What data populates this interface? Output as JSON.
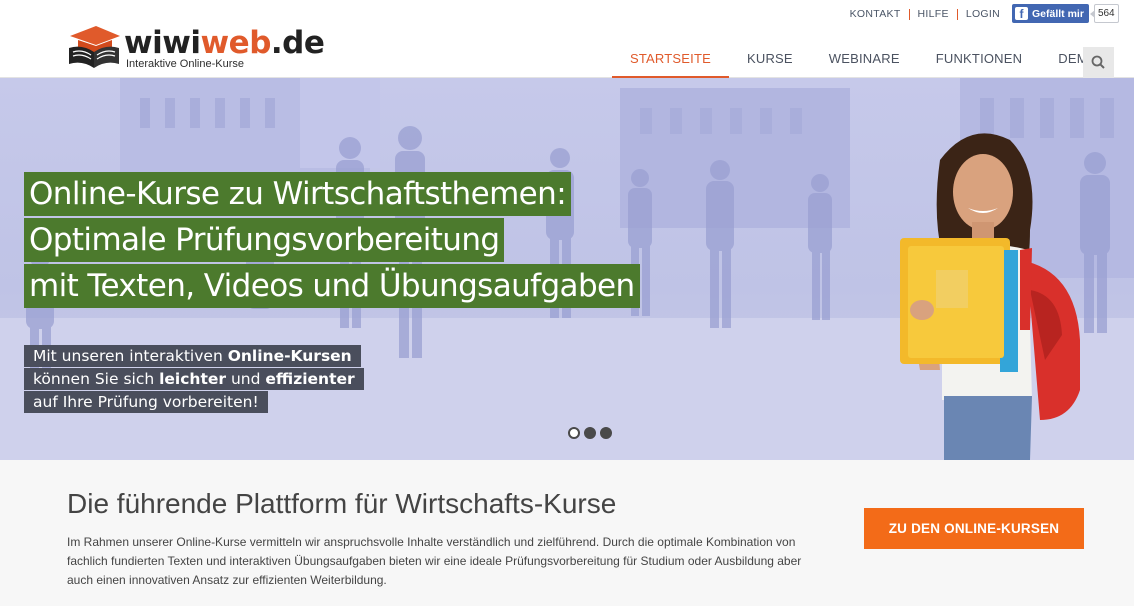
{
  "logo": {
    "word_a": "wiwi",
    "word_b": "web",
    "word_c": ".de",
    "tagline": "Interaktive Online-Kurse"
  },
  "util_nav": {
    "kontakt": "KONTAKT",
    "hilfe": "HILFE",
    "login": "LOGIN"
  },
  "facebook": {
    "like_label": "Gefällt mir",
    "count": "564"
  },
  "nav": {
    "items": [
      "STARTSEITE",
      "KURSE",
      "WEBINARE",
      "FUNKTIONEN",
      "DEMO"
    ],
    "active_index": 0
  },
  "hero": {
    "headline": [
      "Online-Kurse zu Wirtschaftsthemen:",
      "Optimale Prüfungsvorbereitung",
      "mit Texten, Videos und Übungsaufgaben"
    ],
    "sub": {
      "l1_pre": "Mit unseren interaktiven ",
      "l1_bold": "Online-Kursen",
      "l2_pre": "können Sie sich ",
      "l2_bold1": "leichter",
      "l2_mid": " und ",
      "l2_bold2": "effizienter",
      "l3": "auf Ihre Prüfung vorbereiten!"
    },
    "slides": {
      "count": 3,
      "active": 0
    }
  },
  "intro": {
    "title": "Die führende Plattform für Wirtschafts-Kurse",
    "text": "Im Rahmen unserer Online-Kurse vermitteln wir anspruchsvolle Inhalte verständlich und zielführend. Durch die optimale Kombination von fachlich fundierten Texten und interaktiven Übungsaufgaben bieten wir eine ideale Prüfungsvorbereitung für Studium oder Ausbildung aber auch einen innovativen Ansatz zur effizienten Weiterbildung.",
    "cta": "ZU DEN ONLINE-KURSEN"
  },
  "colors": {
    "accent": "#e05a2b",
    "cta": "#f36b18",
    "headline_bg": "#4c7a2d",
    "sub_bg": "#4a4e5c",
    "facebook": "#4267b2"
  }
}
